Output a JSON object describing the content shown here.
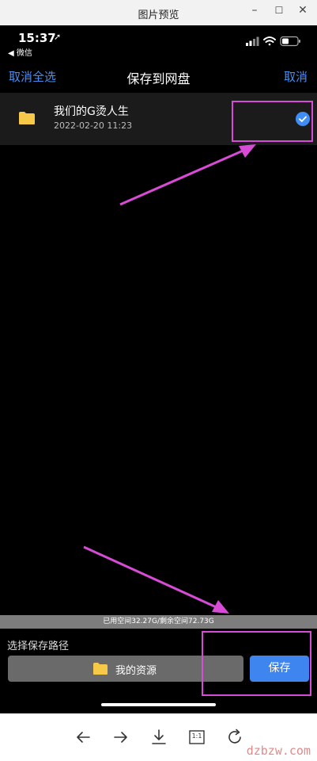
{
  "window": {
    "title": "图片预览",
    "controls": {
      "minimize": "–",
      "maximize": "☐",
      "close": "✕"
    }
  },
  "status_bar": {
    "time": "15:37",
    "location_glyph": "➚",
    "back_app": "◀ 微信"
  },
  "nav": {
    "left_label": "取消全选",
    "title": "保存到网盘",
    "right_label": "取消"
  },
  "file": {
    "name": "我们的G烫人生",
    "date": "2022-02-20 11:23",
    "selected": true
  },
  "storage": {
    "text": "已用空间32.27G/剩余空间72.73G"
  },
  "save_path": {
    "label": "选择保存路径",
    "folder": "我的资源",
    "save_label": "保存"
  },
  "toolbar": {
    "items": [
      "back-arrow-icon",
      "forward-arrow-icon",
      "download-icon",
      "actual-size-icon",
      "rotate-icon"
    ],
    "actual_size_label": "1:1"
  },
  "watermark": "dzbzw.com",
  "colors": {
    "accent": "#4a8ef0",
    "annotation": "#d84bd6",
    "folder": "#f7c948",
    "save_button": "#3e85ef"
  }
}
